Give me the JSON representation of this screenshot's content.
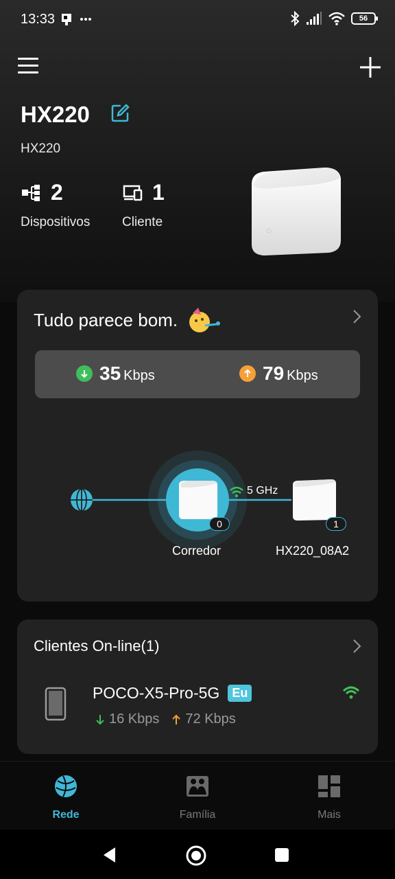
{
  "status_bar": {
    "time": "13:33",
    "battery": "56"
  },
  "header": {
    "title": "HX220",
    "subtitle": "HX220"
  },
  "stats": {
    "devices": {
      "count": "2",
      "label": "Dispositivos"
    },
    "clients": {
      "count": "1",
      "label": "Cliente"
    }
  },
  "status_card": {
    "title": "Tudo parece bom.",
    "download": {
      "value": "35",
      "unit": "Kbps"
    },
    "upload": {
      "value": "79",
      "unit": "Kbps"
    },
    "topology": {
      "main_node": {
        "label": "Corredor",
        "count": "0"
      },
      "satellite": {
        "label": "HX220_08A2",
        "count": "1"
      },
      "band": "5 GHz"
    }
  },
  "clients_card": {
    "title": "Clientes On-line(1)",
    "client": {
      "name": "POCO-X5-Pro-5G",
      "badge": "Eu",
      "down": "16 Kbps",
      "up": "72 Kbps"
    }
  },
  "bottom_nav": {
    "items": [
      {
        "label": "Rede"
      },
      {
        "label": "Família"
      },
      {
        "label": "Mais"
      }
    ]
  },
  "colors": {
    "accent": "#3fb8d6",
    "download": "#3fbf5a",
    "upload": "#f5a038",
    "wifi": "#3fbf5a"
  }
}
